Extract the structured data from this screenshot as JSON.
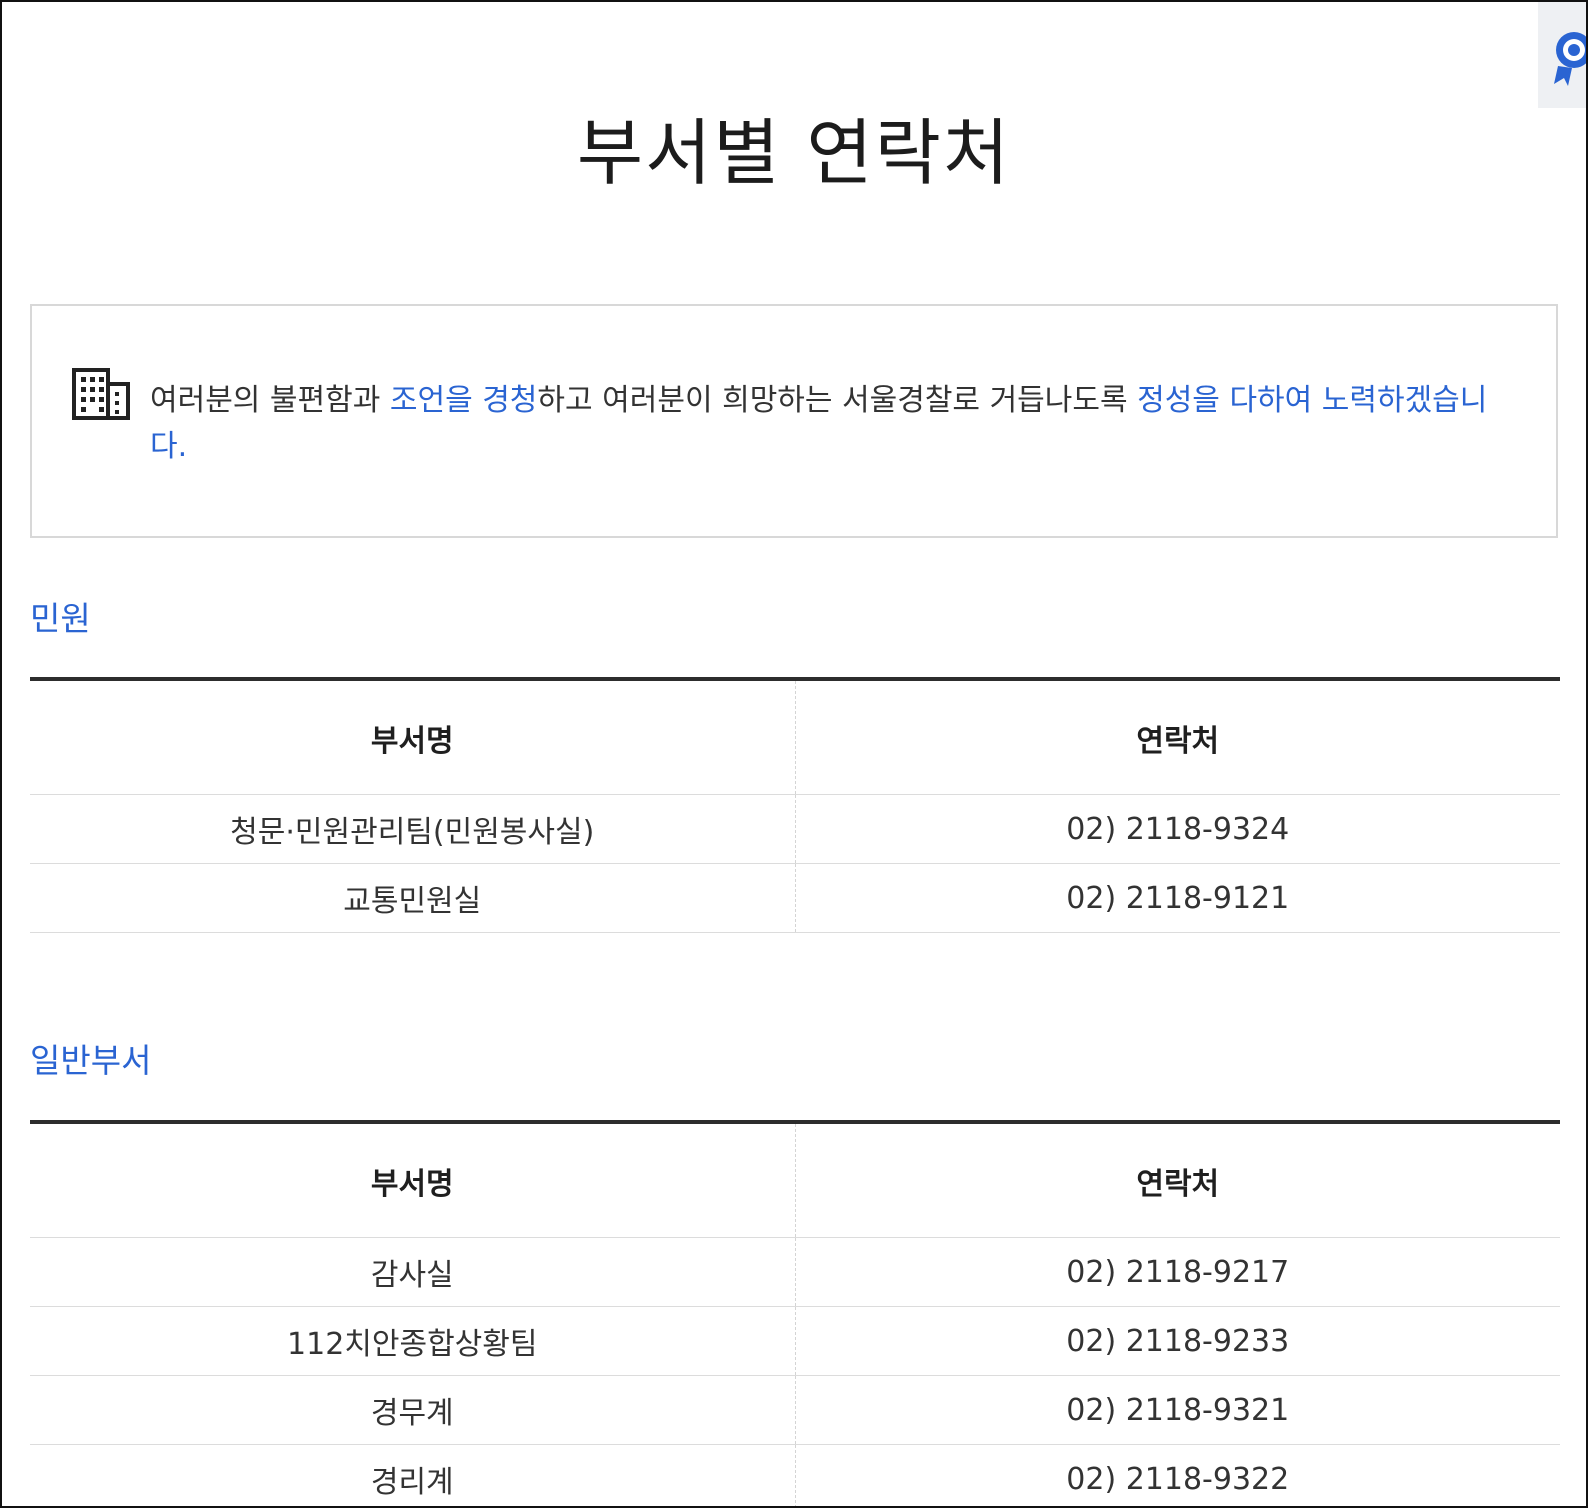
{
  "page": {
    "title": "부서별 연락처"
  },
  "notice": {
    "icon": "building-icon",
    "text_1": "여러분의 불편함과 ",
    "highlight_1": "조언을 경청",
    "text_2": "하고 여러분이 희망하는 서울경찰로 거듭나도록 ",
    "highlight_2": "정성을 다하여 노력하겠습니다."
  },
  "sections": [
    {
      "title": "민원",
      "columns": [
        "부서명",
        "연락처"
      ],
      "rows": [
        [
          "청문·민원관리팀(민원봉사실)",
          "02) 2118-9324"
        ],
        [
          "교통민원실",
          "02) 2118-9121"
        ]
      ]
    },
    {
      "title": "일반부서",
      "columns": [
        "부서명",
        "연락처"
      ],
      "rows": [
        [
          "감사실",
          "02) 2118-9217"
        ],
        [
          "112치안종합상황팀",
          "02) 2118-9233"
        ],
        [
          "경무계",
          "02) 2118-9321"
        ],
        [
          "경리계",
          "02) 2118-9322"
        ]
      ]
    }
  ],
  "colors": {
    "accent": "#2a64d2",
    "table_top_border": "#2d2d2d",
    "row_divider": "#dcdcdc"
  }
}
